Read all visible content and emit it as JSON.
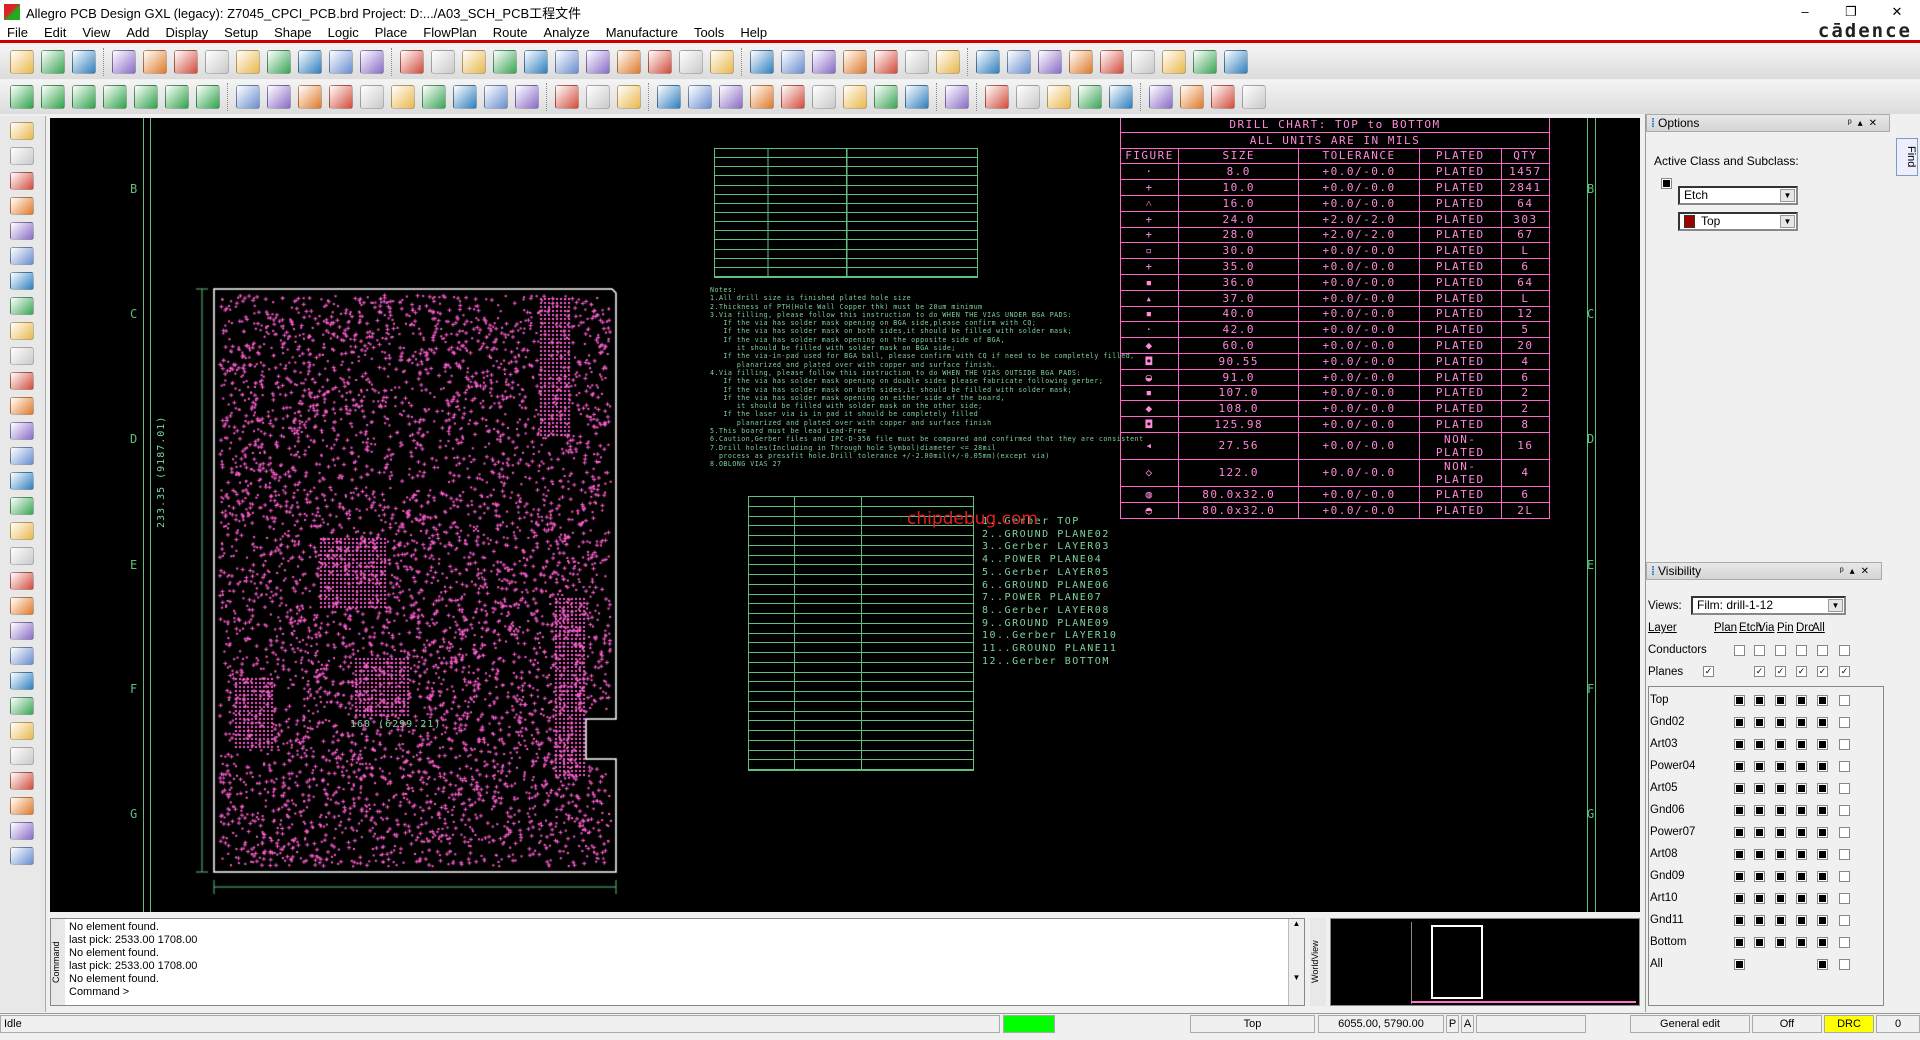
{
  "window": {
    "title": "Allegro PCB Design GXL (legacy): Z7045_CPCI_PCB.brd  Project: D:.../A03_SCH_PCB工程文件",
    "brand": "cādence",
    "minimize": "–",
    "maximize": "❐",
    "close": "✕"
  },
  "menu": [
    "File",
    "Edit",
    "View",
    "Add",
    "Display",
    "Setup",
    "Shape",
    "Logic",
    "Place",
    "FlowPlan",
    "Route",
    "Analyze",
    "Manufacture",
    "Tools",
    "Help"
  ],
  "toolbar_row1": [
    "new-file",
    "open-file",
    "save",
    "sep",
    "move",
    "copy",
    "delete",
    "undo",
    "redo-down",
    "redo",
    "redo-down2",
    "shape-fill",
    "pin",
    "sep",
    "grid-toggle",
    "zoom-fit",
    "zoom-in-area",
    "zoom-points",
    "zoom-in",
    "zoom-out",
    "zoom-world",
    "zoom-prev",
    "refresh",
    "3d-view",
    "flip",
    "sep",
    "grid",
    "color",
    "layers",
    "stackup",
    "cm-table",
    "dfa",
    "3d-plan",
    "sep",
    "info",
    "property",
    "measure",
    "paint",
    "shadow-light",
    "shadow-dim",
    "column-chart",
    "hourglass",
    "drc-stop"
  ],
  "toolbar_row2": [
    "etch-add",
    "etch-via",
    "etch-route",
    "etch-fanout",
    "etch-slide",
    "etch-disabled",
    "etch-edit",
    "sep",
    "add-line",
    "add-rect",
    "add-circle",
    "select",
    "add-poly",
    "add-arc",
    "add-frame",
    "add-oval",
    "shape-edit",
    "delete-shape",
    "sep",
    "place-comp",
    "dim-linear",
    "dim-measure",
    "sep",
    "odb",
    "swap",
    "wire",
    "snapshot",
    "refdes",
    "flag",
    "matrix",
    "test-point",
    "array",
    "sep",
    "waveform",
    "sep",
    "sig-1",
    "sig-2",
    "sig-3",
    "sig-4",
    "sig-5",
    "sep",
    "copy-out",
    "xnet",
    "window",
    "help"
  ],
  "colors": {
    "canvas": "#000000",
    "drill_chart": "#ff66cc",
    "doc_green": "#7fd39a",
    "board_pink": "#ff5fd0",
    "active_layer": "#a00000",
    "status_green": "#00ff00",
    "drc_yellow": "#ffff00"
  },
  "ruler_letters": [
    "B",
    "C",
    "D",
    "E",
    "F",
    "G"
  ],
  "drill_chart": {
    "title": "DRILL CHART: TOP to BOTTOM",
    "subtitle": "ALL UNITS ARE IN MILS",
    "headers": [
      "FIGURE",
      "SIZE",
      "TOLERANCE",
      "PLATED",
      "QTY"
    ],
    "rows": [
      [
        "·",
        "8.0",
        "+0.0/-0.0",
        "PLATED",
        "1457"
      ],
      [
        "+",
        "10.0",
        "+0.0/-0.0",
        "PLATED",
        "2841"
      ],
      [
        "˄",
        "16.0",
        "+0.0/-0.0",
        "PLATED",
        "64"
      ],
      [
        "+",
        "24.0",
        "+2.0/-2.0",
        "PLATED",
        "303"
      ],
      [
        "+",
        "28.0",
        "+2.0/-2.0",
        "PLATED",
        "67"
      ],
      [
        "▫",
        "30.0",
        "+0.0/-0.0",
        "PLATED",
        "L"
      ],
      [
        "+",
        "35.0",
        "+0.0/-0.0",
        "PLATED",
        "6"
      ],
      [
        "▪",
        "36.0",
        "+0.0/-0.0",
        "PLATED",
        "64"
      ],
      [
        "▴",
        "37.0",
        "+0.0/-0.0",
        "PLATED",
        "L"
      ],
      [
        "▪",
        "40.0",
        "+0.0/-0.0",
        "PLATED",
        "12"
      ],
      [
        "·",
        "42.0",
        "+0.0/-0.0",
        "PLATED",
        "5"
      ],
      [
        "◆",
        "60.0",
        "+0.0/-0.0",
        "PLATED",
        "20"
      ],
      [
        "◘",
        "90.55",
        "+0.0/-0.0",
        "PLATED",
        "4"
      ],
      [
        "◒",
        "91.0",
        "+0.0/-0.0",
        "PLATED",
        "6"
      ],
      [
        "▪",
        "107.0",
        "+0.0/-0.0",
        "PLATED",
        "2"
      ],
      [
        "◆",
        "108.0",
        "+0.0/-0.0",
        "PLATED",
        "2"
      ],
      [
        "◘",
        "125.98",
        "+0.0/-0.0",
        "PLATED",
        "8"
      ],
      [
        "◂",
        "27.56",
        "+0.0/-0.0",
        "NON-PLATED",
        "16"
      ],
      [
        "◇",
        "122.0",
        "+0.0/-0.0",
        "NON-PLATED",
        "4"
      ],
      [
        "◍",
        "80.0x32.0",
        "+0.0/-0.0",
        "PLATED",
        "6"
      ],
      [
        "◓",
        "80.0x32.0",
        "+0.0/-0.0",
        "PLATED",
        "2L"
      ]
    ]
  },
  "notes": "Notes:\n1.All drill size is finished plated hole size\n2.Thickness of PTH(Hole Wall Copper thk) must be 20um minimum\n3.Via filling, please follow this instruction to do WHEN THE VIAS UNDER BGA PADS:\n   If the via has solder mask opening on BGA side,please confirm with CQ;\n   If the via has solder mask on both sides,it should be filled with solder mask;\n   If the via has solder mask opening on the opposite side of BGA,\n      it should be filled with solder mask on BGA side;\n   If the via-in-pad used for BGA ball, please confirm with CQ if need to be completely filled,\n      planarized and plated over with copper and surface finish.\n4.Via filling, please follow this instruction to do WHEN THE VIAS OUTSIDE BGA PADS:\n   If the via has solder mask opening on double sides please fabricate following gerber;\n   If the via has solder mask on both sides,it should be filled with solder mask;\n   If the via has solder mask opening on either side of the board,\n      it should be filled with solder mask on the other side;\n   If the laser via is in pad it should be completely filled\n      planarized and plated over with copper and surface finish\n5.This board must be lead Lead-Free\n6.Caution,Gerber files and IPC-D-356 file must be compared and confirmed that they are consistent\n7.Drill holes(Including in Through hole Symbol)diameter <= 28mil\n  process as pressfit hole.Drill tolerance +/-2.00mil(+/-0.05mm)(except via)\n8.OBLONG VIAS 27",
  "stackup_layers": [
    "1..Gerber TOP",
    "2..GROUND PLANE02",
    "3..Gerber LAYER03",
    "4..POWER PLANE04",
    "5..Gerber LAYER05",
    "6..GROUND PLANE06",
    "7..POWER PLANE07",
    "8..Gerber LAYER08",
    "9..GROUND PLANE09",
    "10..Gerber LAYER10",
    "11..GROUND PLANE11",
    "12..Gerber BOTTOM"
  ],
  "watermark": "chipdebug.com",
  "board_dims": {
    "width": "160 (6299.21)",
    "height": "233.35 (9187.01)"
  },
  "options": {
    "title": "Options",
    "label": "Active Class and Subclass:",
    "class_value": "Etch",
    "subclass_value": "Top",
    "find_tab": "Find"
  },
  "visibility": {
    "title": "Visibility",
    "views_label": "Views:",
    "views_value": "Film: drill-1-12",
    "columns": [
      "Layer",
      "Plan",
      "Etch",
      "Via",
      "Pin",
      "Drc",
      "All"
    ],
    "conductors": {
      "label": "Conductors",
      "checked": [
        false,
        false,
        false,
        false,
        false,
        false
      ]
    },
    "planes": {
      "label": "Planes",
      "checked": [
        true,
        true,
        true,
        true,
        true,
        true
      ]
    },
    "layers": [
      {
        "name": "Top",
        "on": [
          true,
          true,
          true,
          true,
          true,
          false
        ]
      },
      {
        "name": "Gnd02",
        "on": [
          true,
          true,
          true,
          true,
          true,
          false
        ]
      },
      {
        "name": "Art03",
        "on": [
          true,
          true,
          true,
          true,
          true,
          false
        ]
      },
      {
        "name": "Power04",
        "on": [
          true,
          true,
          true,
          true,
          true,
          false
        ]
      },
      {
        "name": "Art05",
        "on": [
          true,
          true,
          true,
          true,
          true,
          false
        ]
      },
      {
        "name": "Gnd06",
        "on": [
          true,
          true,
          true,
          true,
          true,
          false
        ]
      },
      {
        "name": "Power07",
        "on": [
          true,
          true,
          true,
          true,
          true,
          false
        ]
      },
      {
        "name": "Art08",
        "on": [
          true,
          true,
          true,
          true,
          true,
          false
        ]
      },
      {
        "name": "Gnd09",
        "on": [
          true,
          true,
          true,
          true,
          true,
          false
        ]
      },
      {
        "name": "Art10",
        "on": [
          true,
          true,
          true,
          true,
          true,
          false
        ]
      },
      {
        "name": "Gnd11",
        "on": [
          true,
          true,
          true,
          true,
          true,
          false
        ]
      },
      {
        "name": "Bottom",
        "on": [
          true,
          true,
          true,
          true,
          true,
          false
        ]
      },
      {
        "name": "All",
        "on": [
          true,
          null,
          null,
          null,
          true,
          false
        ]
      }
    ]
  },
  "command": {
    "tab": "Command",
    "lines": [
      "No element found.",
      "last pick:  2533.00 1708.00",
      "No element found.",
      "last pick:  2533.00 1708.00",
      "No element found.",
      "Command >"
    ]
  },
  "worldview": {
    "tab": "WorldView"
  },
  "status": {
    "state": "Idle",
    "layer": "Top",
    "coords": "6055.00, 5790.00",
    "p": "P",
    "a": "A",
    "mode": "General edit",
    "off": "Off",
    "drc": "DRC",
    "count": "0"
  }
}
